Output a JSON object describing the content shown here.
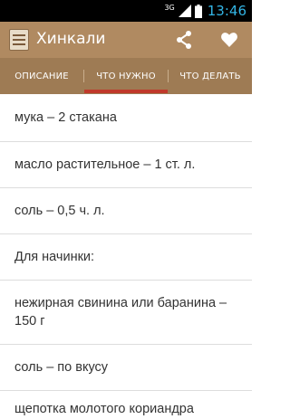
{
  "status_bar": {
    "network": "3G",
    "time": "13:46"
  },
  "action_bar": {
    "title": "Хинкали",
    "icons": [
      "app-logo-icon",
      "share-icon",
      "heart-icon"
    ]
  },
  "tabs": [
    {
      "label": "ОПИСАНИЕ",
      "selected": false
    },
    {
      "label": "ЧТО НУЖНО",
      "selected": true
    },
    {
      "label": "ЧТО ДЕЛАТЬ",
      "selected": false
    }
  ],
  "ingredients": [
    "мука – 2 стакана",
    "масло растительное – 1 ст. л.",
    "соль – 0,5 ч. л.",
    "Для начинки:",
    "нежирная свинина или баранина – 150 г",
    "соль – по вкусу",
    "щепотка молотого кориандра"
  ],
  "colors": {
    "action_bar": "#b08a61",
    "tab_bar": "#9e7b54",
    "tab_indicator": "#c0392b",
    "status_time": "#33b5e5"
  }
}
